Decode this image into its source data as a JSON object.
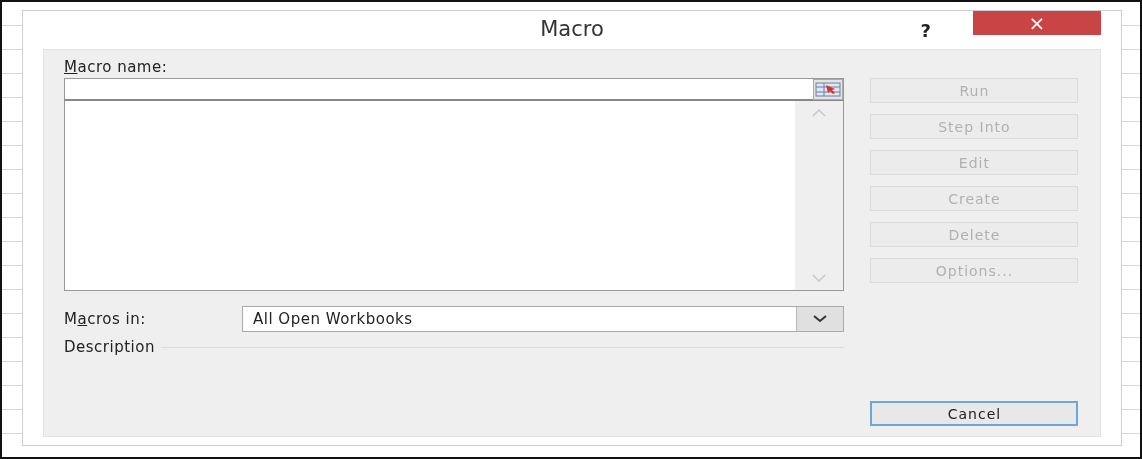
{
  "window": {
    "title": "Macro",
    "help": "?",
    "close": "×"
  },
  "macro_name": {
    "label": "Macro name:"
  },
  "buttons": [
    {
      "label": "Run",
      "disabled": true
    },
    {
      "label": "Step Into",
      "disabled": true
    },
    {
      "label": "Edit",
      "disabled": true
    },
    {
      "label": "Create",
      "disabled": true
    },
    {
      "label": "Delete",
      "disabled": true
    },
    {
      "label": "Options...",
      "disabled": true
    }
  ],
  "macros_in": {
    "label": "Macros in:",
    "value": "All Open Workbooks"
  },
  "description": {
    "label": "Description"
  },
  "cancel_button": {
    "label": "Cancel",
    "disabled": false
  }
}
